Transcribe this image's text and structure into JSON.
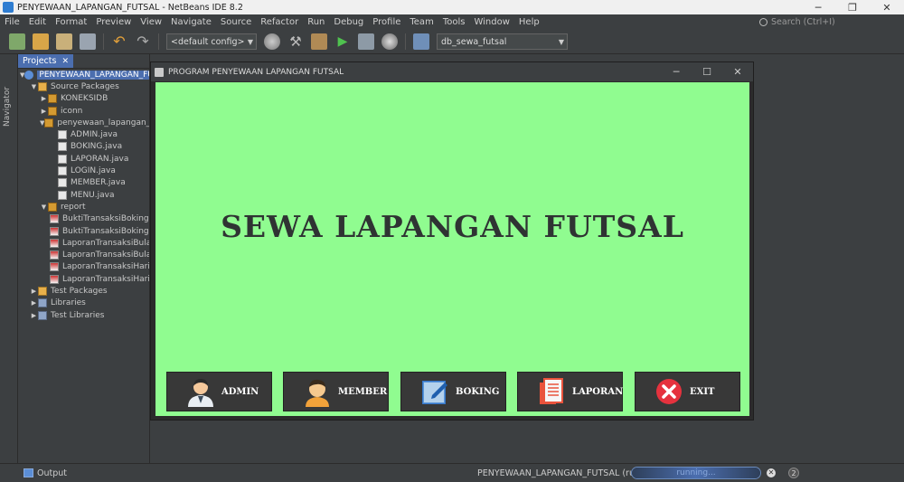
{
  "window": {
    "title": "PENYEWAAN_LAPANGAN_FUTSAL - NetBeans IDE 8.2",
    "min": "─",
    "max": "❐",
    "close": "✕"
  },
  "menu": [
    "File",
    "Edit",
    "Format",
    "Preview",
    "View",
    "Navigate",
    "Source",
    "Refactor",
    "Run",
    "Debug",
    "Profile",
    "Team",
    "Tools",
    "Window",
    "Help"
  ],
  "search": {
    "placeholder": "Search (Ctrl+I)"
  },
  "toolbar": {
    "config_select": "<default config>",
    "db_select": "db_sewa_futsal"
  },
  "side": {
    "navigator": "Navigator"
  },
  "projects": {
    "tab_label": "Projects",
    "tab_close": "✕",
    "tree": [
      {
        "depth": 0,
        "toggle": "▼",
        "icon": "proj",
        "label": "PENYEWAAN_LAPANGAN_FUTSAL",
        "selected": true
      },
      {
        "depth": 1,
        "toggle": "▼",
        "icon": "folder",
        "label": "Source Packages"
      },
      {
        "depth": 2,
        "toggle": "▶",
        "icon": "pkg",
        "label": "KONEKSIDB"
      },
      {
        "depth": 2,
        "toggle": "▶",
        "icon": "pkg",
        "label": "iconn"
      },
      {
        "depth": 2,
        "toggle": "▼",
        "icon": "pkg",
        "label": "penyewaan_lapangan_futsal"
      },
      {
        "depth": 3,
        "toggle": "",
        "icon": "java",
        "label": "ADMIN.java"
      },
      {
        "depth": 3,
        "toggle": "",
        "icon": "java",
        "label": "BOKING.java"
      },
      {
        "depth": 3,
        "toggle": "",
        "icon": "java",
        "label": "LAPORAN.java"
      },
      {
        "depth": 3,
        "toggle": "",
        "icon": "java",
        "label": "LOGIN.java"
      },
      {
        "depth": 3,
        "toggle": "",
        "icon": "java",
        "label": "MEMBER.java"
      },
      {
        "depth": 3,
        "toggle": "",
        "icon": "java",
        "label": "MENU.java"
      },
      {
        "depth": 2,
        "toggle": "▼",
        "icon": "pkg",
        "label": "report"
      },
      {
        "depth": 3,
        "toggle": "",
        "icon": "jasper",
        "label": "BuktiTransaksiBoking.jasper"
      },
      {
        "depth": 3,
        "toggle": "",
        "icon": "jasper",
        "label": "BuktiTransaksiBoking.jrxml"
      },
      {
        "depth": 3,
        "toggle": "",
        "icon": "jasper",
        "label": "LaporanTransaksiBulanan.jasper"
      },
      {
        "depth": 3,
        "toggle": "",
        "icon": "jasper",
        "label": "LaporanTransaksiBulanan.jrxml"
      },
      {
        "depth": 3,
        "toggle": "",
        "icon": "jasper",
        "label": "LaporanTransaksiHarian.jasper"
      },
      {
        "depth": 3,
        "toggle": "",
        "icon": "jasper",
        "label": "LaporanTransaksiHarian.jrxml"
      },
      {
        "depth": 1,
        "toggle": "▶",
        "icon": "folder",
        "label": "Test Packages"
      },
      {
        "depth": 1,
        "toggle": "▶",
        "icon": "lib",
        "label": "Libraries"
      },
      {
        "depth": 1,
        "toggle": "▶",
        "icon": "lib",
        "label": "Test Libraries"
      }
    ]
  },
  "app": {
    "title": "PROGRAM PENYEWAAN LAPANGAN FUTSAL",
    "min": "─",
    "max": "☐",
    "close": "✕",
    "heading": "SEWA LAPANGAN FUTSAL",
    "buttons": [
      {
        "label": "ADMIN",
        "icon": "admin-avatar-icon"
      },
      {
        "label": "MEMBER",
        "icon": "member-avatar-icon"
      },
      {
        "label": "BOKING",
        "icon": "edit-note-icon"
      },
      {
        "label": "LAPORAN",
        "icon": "report-document-icon"
      },
      {
        "label": "EXIT",
        "icon": "close-circle-icon"
      }
    ]
  },
  "status": {
    "output_label": "Output",
    "run_label": "PENYEWAAN_LAPANGAN_FUTSAL (run)",
    "progress_text": "running...",
    "task_count": "2",
    "stop": "✕"
  },
  "colors": {
    "app_background": "#90fc90",
    "button_background": "#383838",
    "heading_text": "#2f3333",
    "exit_red": "#e5323e",
    "ide_dark": "#3c3f41",
    "selection_blue": "#4b6eaf"
  }
}
